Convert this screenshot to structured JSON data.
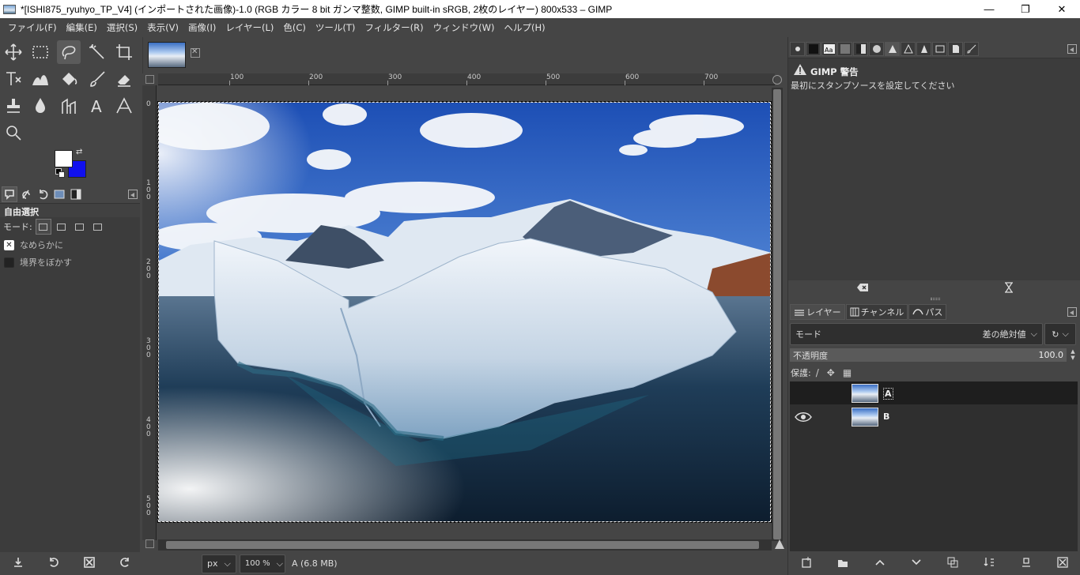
{
  "window": {
    "title": "*[ISHI875_ryuhyo_TP_V4] (インポートされた画像)-1.0 (RGB カラー 8 bit ガンマ整数, GIMP built-in sRGB, 2枚のレイヤー) 800x533 – GIMP",
    "minimize": "—",
    "maximize": "❐",
    "close": "✕"
  },
  "menu": [
    "ファイル(F)",
    "編集(E)",
    "選択(S)",
    "表示(V)",
    "画像(I)",
    "レイヤー(L)",
    "色(C)",
    "ツール(T)",
    "フィルター(R)",
    "ウィンドウ(W)",
    "ヘルプ(H)"
  ],
  "colors": {
    "foreground": "#ffffff",
    "background": "#1010ee"
  },
  "tool_options": {
    "title": "自由選択",
    "mode_label": "モード:",
    "antialias_label": "なめらかに",
    "antialias_checked": true,
    "feather_label": "境界をぼかす",
    "feather_checked": false
  },
  "ruler": {
    "top_ticks": [
      "100",
      "200",
      "300",
      "400",
      "500",
      "600",
      "700"
    ],
    "left_ticks": [
      "0",
      "100",
      "200",
      "300",
      "400",
      "500"
    ]
  },
  "status": {
    "unit": "px",
    "zoom": "100 %",
    "info": "A (6.8 MB)"
  },
  "warning": {
    "title": "GIMP 警告",
    "message": "最初にスタンプソースを設定してください"
  },
  "layers_panel": {
    "tabs": [
      {
        "label": "レイヤー",
        "icon": "layers-icon"
      },
      {
        "label": "チャンネル",
        "icon": "channels-icon"
      },
      {
        "label": "パス",
        "icon": "paths-icon"
      }
    ],
    "mode_label": "モード",
    "mode_value": "差の絶対値",
    "opacity_label": "不透明度",
    "opacity_value": "100.0",
    "lock_label": "保護:",
    "layers": [
      {
        "name": "A",
        "visible": false,
        "selected": true
      },
      {
        "name": "B",
        "visible": true,
        "selected": false
      }
    ]
  }
}
